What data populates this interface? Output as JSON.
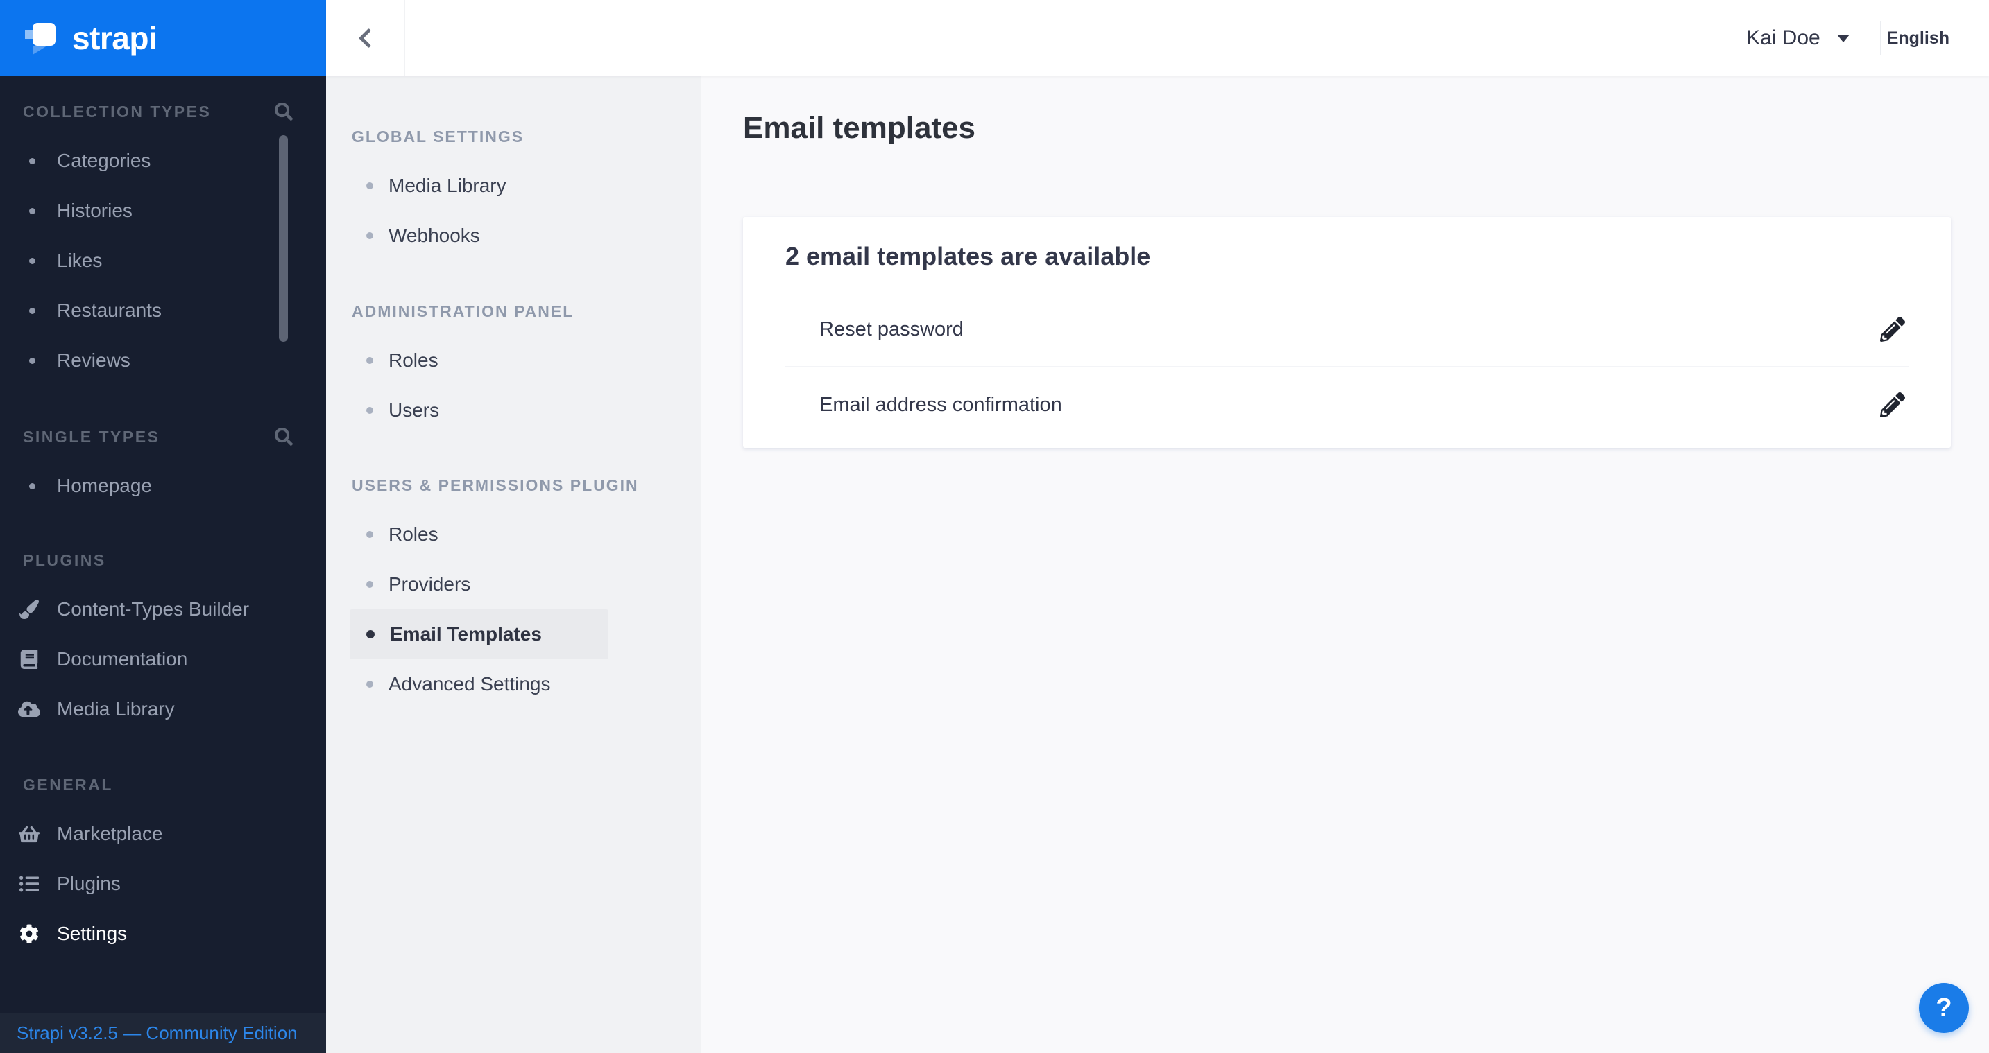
{
  "brand": {
    "name": "strapi",
    "header_color": "#0c75ef"
  },
  "left_nav": {
    "sections": [
      {
        "label": "COLLECTION TYPES",
        "has_search": true,
        "items": [
          {
            "label": "Categories"
          },
          {
            "label": "Histories"
          },
          {
            "label": "Likes"
          },
          {
            "label": "Restaurants"
          },
          {
            "label": "Reviews"
          }
        ]
      },
      {
        "label": "SINGLE TYPES",
        "has_search": true,
        "items": [
          {
            "label": "Homepage"
          }
        ]
      },
      {
        "label": "PLUGINS",
        "items": [
          {
            "label": "Content-Types Builder",
            "icon": "paintbrush-icon"
          },
          {
            "label": "Documentation",
            "icon": "book-icon"
          },
          {
            "label": "Media Library",
            "icon": "cloud-upload-icon"
          }
        ]
      },
      {
        "label": "GENERAL",
        "items": [
          {
            "label": "Marketplace",
            "icon": "basket-icon"
          },
          {
            "label": "Plugins",
            "icon": "list-icon"
          },
          {
            "label": "Settings",
            "icon": "gear-icon",
            "active": true
          }
        ]
      }
    ],
    "footer_version": "Strapi v3.2.5 — Community Edition"
  },
  "topbar": {
    "user_name": "Kai Doe",
    "language": "English"
  },
  "settings_nav": {
    "sections": [
      {
        "label": "GLOBAL SETTINGS",
        "items": [
          {
            "label": "Media Library"
          },
          {
            "label": "Webhooks"
          }
        ]
      },
      {
        "label": "ADMINISTRATION PANEL",
        "items": [
          {
            "label": "Roles"
          },
          {
            "label": "Users"
          }
        ]
      },
      {
        "label": "USERS & PERMISSIONS PLUGIN",
        "items": [
          {
            "label": "Roles"
          },
          {
            "label": "Providers"
          },
          {
            "label": "Email Templates",
            "active": true
          },
          {
            "label": "Advanced Settings"
          }
        ]
      }
    ]
  },
  "main": {
    "page_title": "Email templates",
    "card": {
      "title": "2 email templates are available",
      "rows": [
        {
          "label": "Reset password"
        },
        {
          "label": "Email address confirmation"
        }
      ]
    }
  },
  "help": {
    "label": "?"
  },
  "colors": {
    "accent_blue": "#0c75ef",
    "help_blue": "#1a7ce8",
    "footer_link_blue": "#2c86e9",
    "dark_sidebar_bg": "#171e2f",
    "settings_sidebar_bg": "#f1f2f4",
    "selected_item_bg": "#e9eaed"
  }
}
